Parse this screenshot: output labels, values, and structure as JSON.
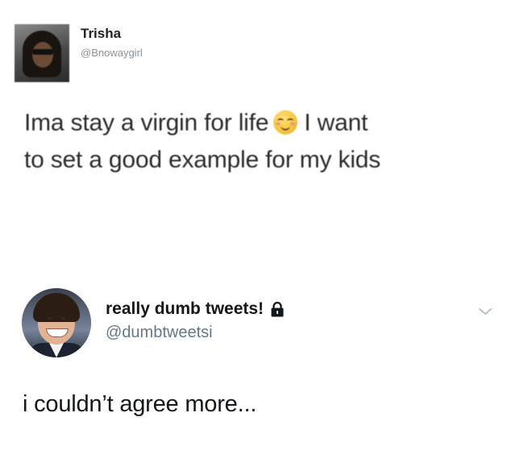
{
  "quoted_tweet": {
    "author_name": "Trisha",
    "author_handle": "@Bnowaygirl",
    "text_part_1": "Ima stay a virgin for life",
    "emoji_icon": "relieved-face-emoji",
    "text_part_2": "I want",
    "text_line_2": "to set a good example for my kids"
  },
  "tweet": {
    "author_name": "really dumb tweets!",
    "protected_icon": "lock-icon",
    "author_handle": "@dumbtweetsi",
    "text": "i couldn’t agree more...",
    "menu_icon": "chevron-down-icon"
  },
  "colors": {
    "text": "#14171a",
    "handle": "#657786",
    "chevron": "#aab8c2"
  }
}
